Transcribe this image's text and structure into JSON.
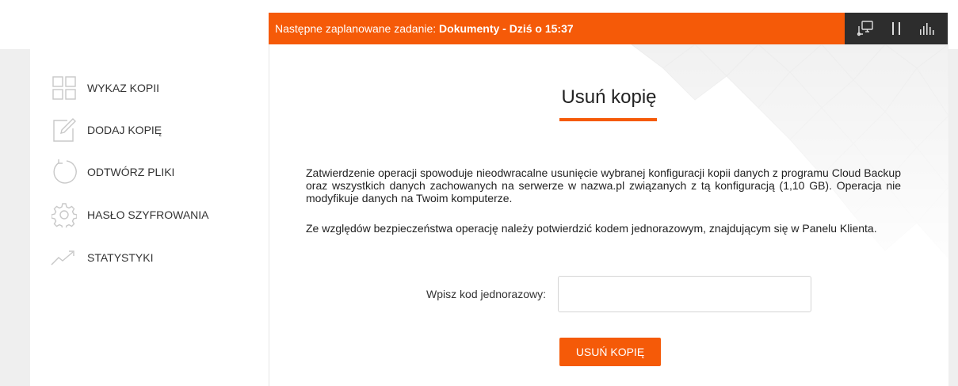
{
  "topbar": {
    "message_prefix": "Następne zaplanowane zadanie: ",
    "message_bold": "Dokumenty - Dziś o 15:37",
    "accent": "#f55a08",
    "tools_bg": "#2d2d2d",
    "tools": [
      {
        "icon": "network-computer-icon"
      },
      {
        "icon": "pause-icon"
      },
      {
        "icon": "bar-chart-icon"
      }
    ]
  },
  "sidebar": {
    "items": [
      {
        "label": "WYKAZ KOPII",
        "icon": "grid-icon"
      },
      {
        "label": "DODAJ KOPIĘ",
        "icon": "edit-icon"
      },
      {
        "label": "ODTWÓRZ PLIKI",
        "icon": "restore-icon"
      },
      {
        "label": "HASŁO SZYFROWANIA",
        "icon": "gear-icon"
      },
      {
        "label": "STATYSTYKI",
        "icon": "trend-icon"
      }
    ]
  },
  "main": {
    "title": "Usuń kopię",
    "paragraph1": "Zatwierdzenie operacji spowoduje nieodwracalne usunięcie wybranej konfiguracji kopii danych z programu Cloud Backup oraz wszystkich danych zachowanych na serwerze w nazwa.pl związanych z tą konfiguracją (1,10 GB). Operacja nie modyfikuje danych na Twoim komputerze.",
    "paragraph2": "Ze względów bezpieczeństwa operację należy potwierdzić kodem jednorazowym, znajdującym się w Panelu Klienta.",
    "code_label": "Wpisz kod jednorazowy:",
    "code_value": "",
    "code_placeholder": "",
    "submit_label": "USUŃ KOPIĘ"
  }
}
